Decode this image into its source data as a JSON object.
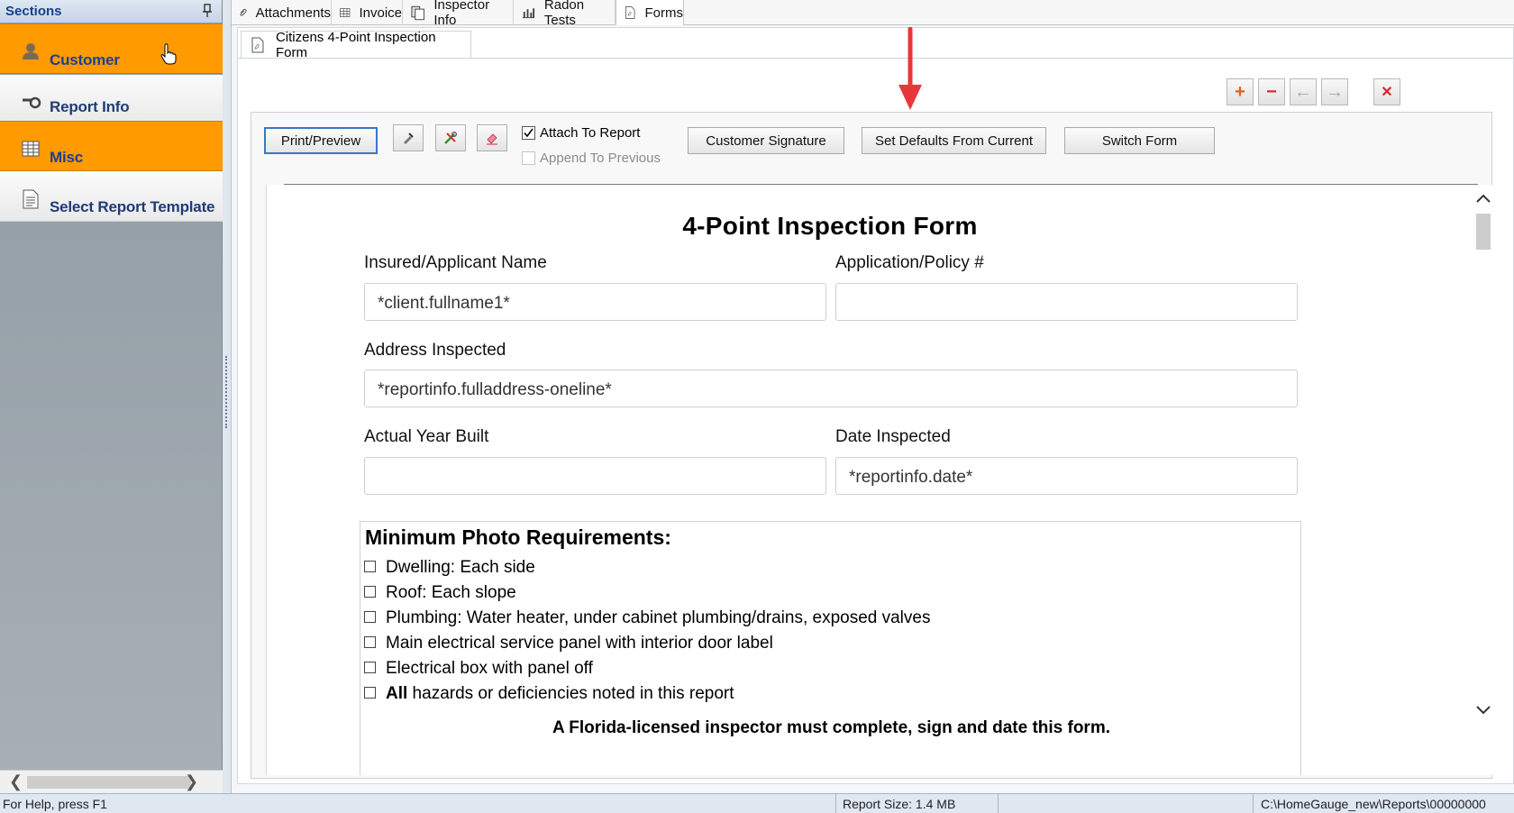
{
  "sidebar": {
    "title": "Sections",
    "items": [
      {
        "label": "Customer",
        "state": "active",
        "icon": "person-icon"
      },
      {
        "label": "Report Info",
        "state": "inactive",
        "icon": "magnifier-icon"
      },
      {
        "label": "Misc",
        "state": "active",
        "icon": "grid-icon"
      },
      {
        "label": "Select Report Template",
        "state": "inactive",
        "icon": "document-icon"
      }
    ]
  },
  "top_tabs": [
    {
      "label": "Attachments",
      "icon": "paperclip-icon"
    },
    {
      "label": "Invoice",
      "icon": "table-icon"
    },
    {
      "label": "Inspector Info",
      "icon": "documents-icon"
    },
    {
      "label": "Radon Tests",
      "icon": "bar-chart-icon"
    },
    {
      "label": "Forms",
      "icon": "pdf-icon",
      "selected": true
    }
  ],
  "form_tab": {
    "label": "Citizens 4-Point Inspection Form",
    "icon": "pdf-icon"
  },
  "nav_buttons": [
    {
      "name": "add",
      "glyph": "+",
      "color": "#e2621b"
    },
    {
      "name": "remove",
      "glyph": "−",
      "color": "#d8272c"
    },
    {
      "name": "prev",
      "glyph": "←",
      "color": "#a9a9a9"
    },
    {
      "name": "next",
      "glyph": "→",
      "color": "#a9a9a9"
    },
    {
      "name": "close",
      "glyph": "✕",
      "color": "#d8272c"
    }
  ],
  "toolbar": {
    "print_preview": "Print/Preview",
    "attach_to_report": "Attach To Report",
    "attach_checked": true,
    "append_to_previous": "Append To Previous",
    "append_checked": false,
    "customer_signature": "Customer Signature",
    "set_defaults": "Set Defaults From Current",
    "switch_form": "Switch Form"
  },
  "form": {
    "title": "4-Point Inspection Form",
    "fields": {
      "insured_label": "Insured/Applicant Name",
      "insured_value": "*client.fullname1*",
      "policy_label": "Application/Policy #",
      "policy_value": "",
      "address_label": "Address Inspected",
      "address_value": "*reportinfo.fulladdress-oneline*",
      "year_label": "Actual Year Built",
      "year_value": "",
      "date_label": "Date Inspected",
      "date_value": "*reportinfo.date*"
    },
    "photo_title": "Minimum Photo Requirements:",
    "photo_items": [
      {
        "bold": "",
        "text": "Dwelling: Each side"
      },
      {
        "bold": "",
        "text": "Roof: Each slope"
      },
      {
        "bold": "",
        "text": "Plumbing: Water heater, under cabinet plumbing/drains, exposed valves"
      },
      {
        "bold": "",
        "text": "Main electrical service panel with interior door label"
      },
      {
        "bold": "",
        "text": "Electrical box with panel off"
      },
      {
        "bold": "All",
        "text": " hazards or deficiencies noted in this report"
      }
    ],
    "florida_note": "A Florida-licensed inspector must complete, sign and date this form."
  },
  "status": {
    "help": "For Help, press F1",
    "report_size": "Report Size: 1.4 MB",
    "path": "C:\\HomeGauge_new\\Reports\\00000000"
  },
  "colors": {
    "accent_orange": "#ff9a00",
    "nav_blue": "#1f3b77",
    "arrow_red": "#e8373b"
  }
}
